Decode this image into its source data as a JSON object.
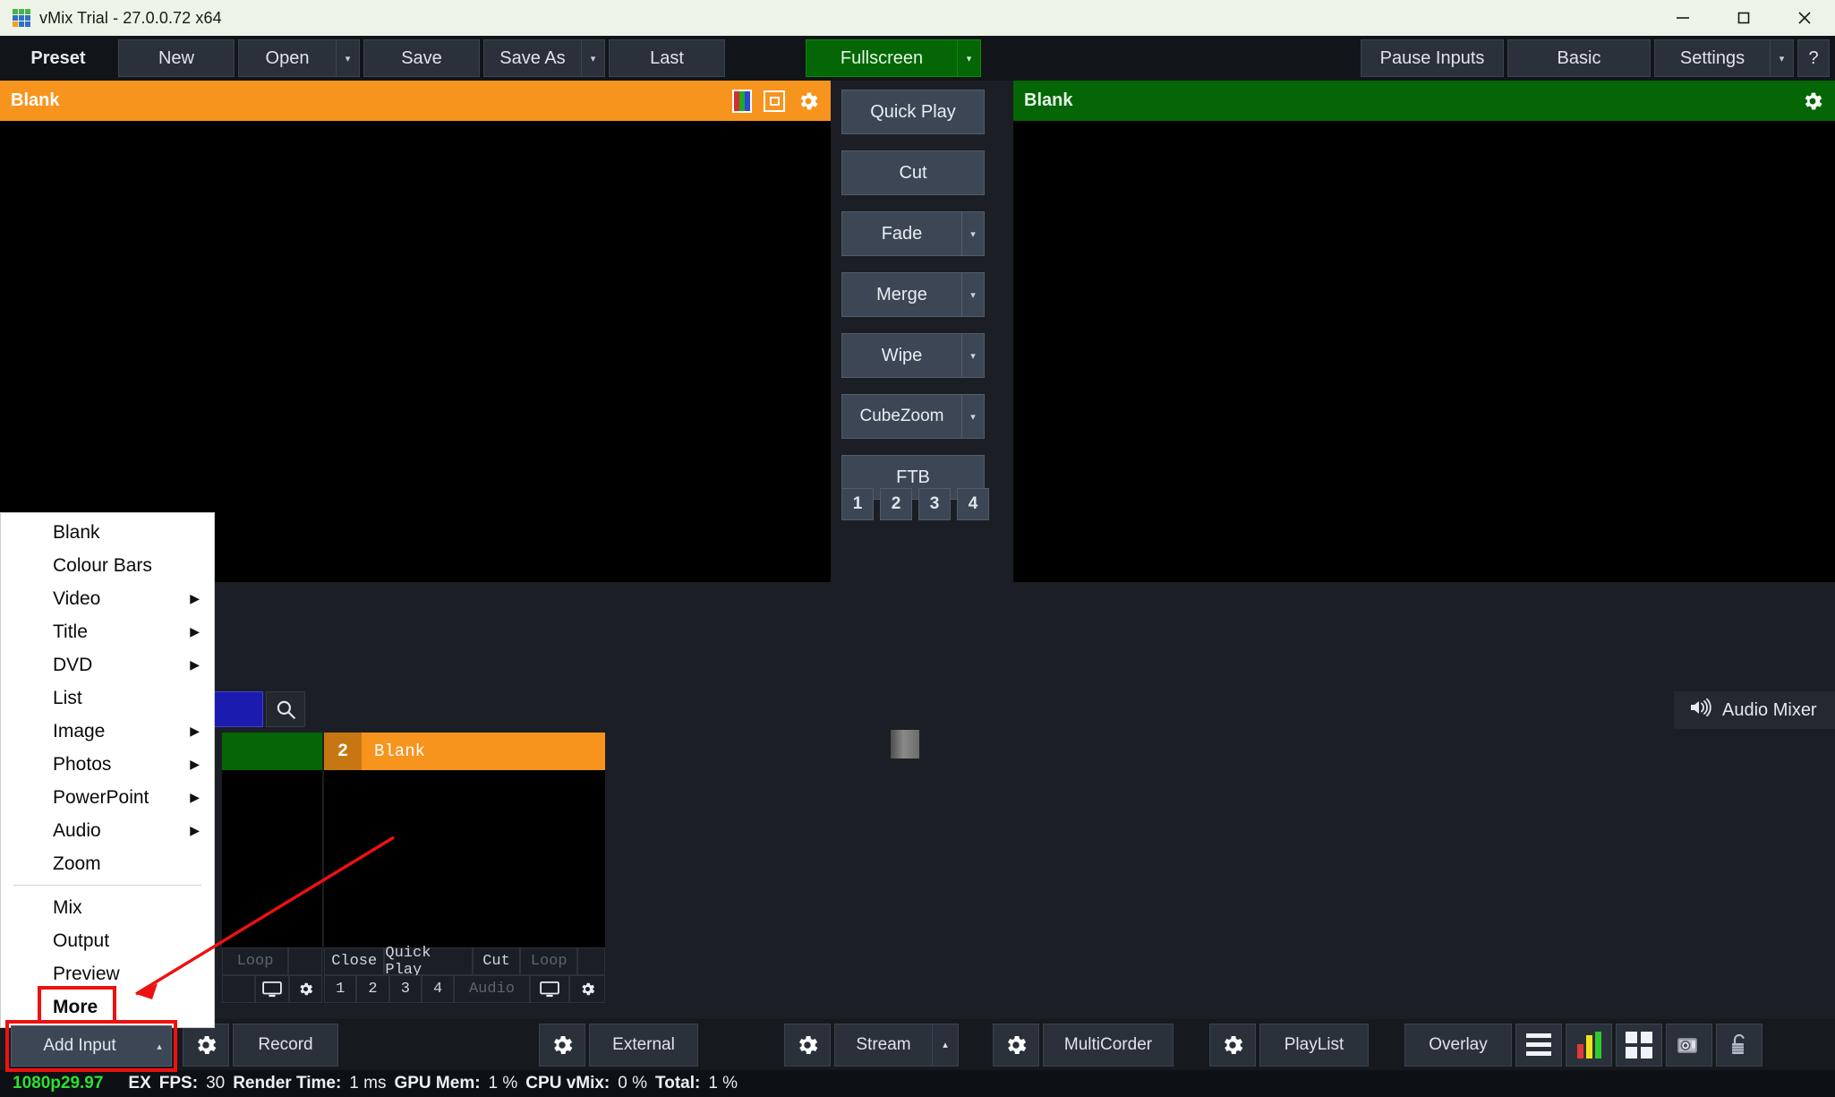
{
  "window": {
    "title": "vMix Trial - 27.0.0.72 x64",
    "app_icon": "vmix-grid-icon",
    "controls": {
      "minimize": "minimize-icon",
      "maximize": "maximize-icon",
      "close": "close-icon"
    }
  },
  "toolbar": {
    "preset_label": "Preset",
    "new": "New",
    "open": "Open",
    "save": "Save",
    "save_as": "Save As",
    "last": "Last",
    "fullscreen": "Fullscreen",
    "pause_inputs": "Pause Inputs",
    "basic": "Basic",
    "settings": "Settings",
    "help": "?"
  },
  "preview_pane": {
    "title": "Blank",
    "icons": [
      "colour-bars-icon",
      "window-icon",
      "gear-icon"
    ]
  },
  "program_pane": {
    "title": "Blank",
    "icons": [
      "gear-icon"
    ]
  },
  "transitions": {
    "quick_play": "Quick Play",
    "cut": "Cut",
    "fade": "Fade",
    "merge": "Merge",
    "wipe": "Wipe",
    "cubezoom": "CubeZoom",
    "ftb": "FTB",
    "numbers": [
      "1",
      "2",
      "3",
      "4"
    ],
    "tbar_position_percent": 38
  },
  "input_bar": {
    "search_icon": "search-icon",
    "audio_mixer_label": "Audio Mixer",
    "audio_mixer_icon": "speaker-icon"
  },
  "inputs": [
    {
      "number": "",
      "name": "",
      "state": "preview",
      "buttons": [
        "Loop"
      ],
      "icons": [
        "monitor-icon",
        "gear-icon"
      ]
    },
    {
      "number": "2",
      "name": "Blank",
      "state": "program",
      "buttons": [
        "Close",
        "Quick Play",
        "Cut",
        "Loop"
      ],
      "num_buttons": [
        "1",
        "2",
        "3",
        "4"
      ],
      "audio_label": "Audio",
      "icons": [
        "monitor-icon",
        "gear-icon"
      ]
    }
  ],
  "context_menu": {
    "items": [
      {
        "label": "Blank",
        "submenu": false
      },
      {
        "label": "Colour Bars",
        "submenu": false
      },
      {
        "label": "Video",
        "submenu": true
      },
      {
        "label": "Title",
        "submenu": true
      },
      {
        "label": "DVD",
        "submenu": true
      },
      {
        "label": "List",
        "submenu": false
      },
      {
        "label": "Image",
        "submenu": true
      },
      {
        "label": "Photos",
        "submenu": true
      },
      {
        "label": "PowerPoint",
        "submenu": true
      },
      {
        "label": "Audio",
        "submenu": true
      },
      {
        "label": "Zoom",
        "submenu": false
      }
    ],
    "items2": [
      {
        "label": "Mix",
        "submenu": false
      },
      {
        "label": "Output",
        "submenu": false
      },
      {
        "label": "Preview",
        "submenu": false
      },
      {
        "label": "More",
        "submenu": false,
        "highlighted": true
      }
    ]
  },
  "bottom_toolbar": {
    "record": "Record",
    "external": "External",
    "stream": "Stream",
    "multicorder": "MultiCorder",
    "playlist": "PlayList",
    "overlay": "Overlay",
    "add_input": "Add Input",
    "icons": [
      "gear-icon",
      "hamburger-icon",
      "audio-meter-icon",
      "quad-grid-icon",
      "camera-icon",
      "lock-icon"
    ]
  },
  "status_bar": {
    "resolution": "1080p29.97",
    "ex": "EX",
    "fps_key": "FPS:",
    "fps_value": "30",
    "render_key": "Render Time:",
    "render_value": "1 ms",
    "gpu_key": "GPU Mem:",
    "gpu_value": "1 %",
    "cpu_key": "CPU vMix:",
    "cpu_value": "0 %",
    "total_key": "Total:",
    "total_value": "1 %"
  },
  "colors": {
    "preview_orange": "#f7941e",
    "program_green": "#046604",
    "highlight_red": "#ee1111",
    "accent_blue": "#0b84f3",
    "status_green": "#2ee02e"
  }
}
